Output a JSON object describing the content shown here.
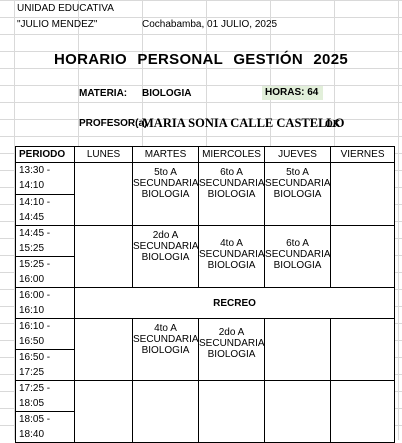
{
  "header": {
    "school": "UNIDAD EDUCATIVA",
    "school_name": "\"JULIO MENDEZ\"",
    "place_date": "Cochabamba, 01 JULIO, 2025"
  },
  "title": "HORARIO   PERSONAL   GESTIÓN 2025",
  "materia": {
    "label": "MATERIA:",
    "value": "BIOLOGIA"
  },
  "horas": {
    "label": "HORAS:",
    "value": "64"
  },
  "profesor": {
    "label": "PROFESOR(a)",
    "name": "MARIA SONIA CALLE CASTELLO",
    "mark": "OK"
  },
  "schedule": {
    "headers": [
      "PERIODO",
      "LUNES",
      "MARTES",
      "MIERCOLES",
      "JUEVES",
      "VIERNES"
    ],
    "times": [
      "13:30 - 14:10",
      "14:10 - 14:45",
      "14:45 - 15:25",
      "15:25 - 16:00",
      "16:00 - 16:10",
      "16:10 - 16:50",
      "16:50 - 17:25",
      "17:25 - 18:05",
      "18:05 - 18:40"
    ],
    "recreo": "RECREO",
    "classes": {
      "b1": {
        "martes": "5to A SECUNDARIA BIOLOGIA",
        "miercoles": "6to A SECUNDARIA BIOLOGIA",
        "jueves": "5to A SECUNDARIA BIOLOGIA"
      },
      "b2": {
        "martes": "2do A SECUNDARIA BIOLOGIA",
        "miercoles": "4to A SECUNDARIA BIOLOGIA",
        "jueves": "6to A SECUNDARIA BIOLOGIA"
      },
      "b3": {
        "martes": "4to A SECUNDARIA BIOLOGIA",
        "miercoles": "2do A SECUNDARIA BIOLOGIA"
      }
    }
  }
}
